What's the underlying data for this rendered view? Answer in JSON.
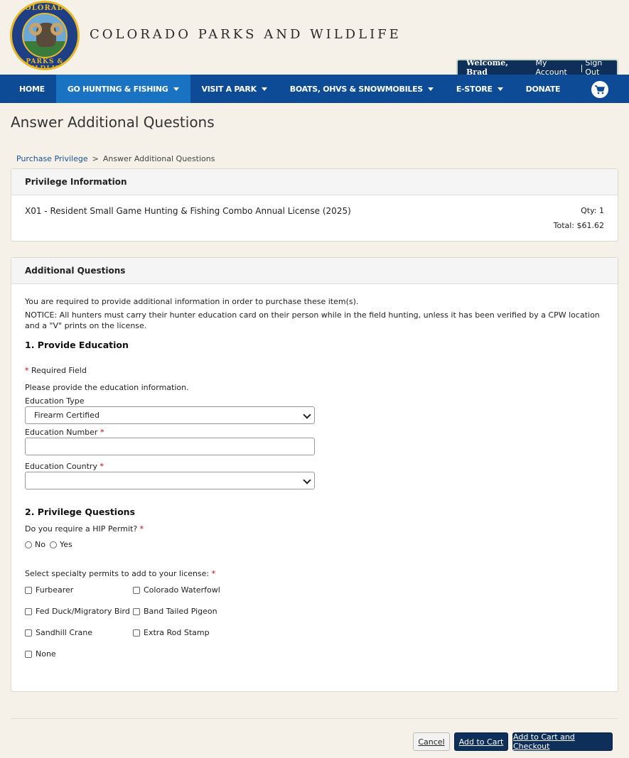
{
  "header": {
    "logo_text_top": "COLORADO",
    "logo_text_bottom": "PARKS & WILDLIFE",
    "site_title": "COLORADO PARKS AND WILDLIFE",
    "welcome": "Welcome, Brad",
    "my_account": "My Account",
    "separator": "|",
    "sign_out": "Sign Out"
  },
  "nav": {
    "items": [
      {
        "label": "HOME"
      },
      {
        "label": "GO HUNTING & FISHING"
      },
      {
        "label": "VISIT A PARK"
      },
      {
        "label": "BOATS, OHVS & SNOWMOBILES"
      },
      {
        "label": "E-STORE"
      },
      {
        "label": "DONATE"
      }
    ],
    "active_color": "#1a73c2",
    "bar_color": "#0d4b97"
  },
  "page": {
    "title": "Answer Additional Questions",
    "breadcrumb": {
      "parent": "Purchase Privilege",
      "separator": ">",
      "current": "Answer Additional Questions"
    }
  },
  "privilege": {
    "heading": "Privilege Information",
    "name": "X01 - Resident Small Game Hunting & Fishing Combo Annual License (2025)",
    "qty": "Qty: 1",
    "total": "Total: $61.62"
  },
  "questions": {
    "heading": "Additional Questions",
    "intro": "You are required to provide additional information in order to purchase these item(s).",
    "notice": "NOTICE: All hunters must carry their hunter education card on their person while in the field hunting, unless it has been verified by a CPW location and a \"V\" prints on the license.",
    "section1": "1. Provide Education",
    "required_marker": "*",
    "required_note": "Required Field",
    "provide_text": "Please provide the education information.",
    "education_type_label": "Education Type",
    "education_type_value": "Firearm Certified",
    "education_number_label": "Education Number",
    "education_number_value": "",
    "education_country_label": "Education Country",
    "education_country_value": "",
    "section2": "2. Privilege Questions",
    "hip_question": "Do you require a HIP Permit?",
    "hip_no": "No",
    "hip_yes": "Yes",
    "specialty_question": "Select specialty permits to add to your license:",
    "permits": [
      "Furbearer",
      "Colorado Waterfowl",
      "Fed Duck/Migratory Bird",
      "Band Tailed Pigeon",
      "Sandhill Crane",
      "Extra Rod Stamp",
      "None"
    ]
  },
  "buttons": {
    "cancel": "Cancel",
    "add_to_cart": "Add to Cart",
    "add_checkout": "Add to Cart and Checkout"
  }
}
